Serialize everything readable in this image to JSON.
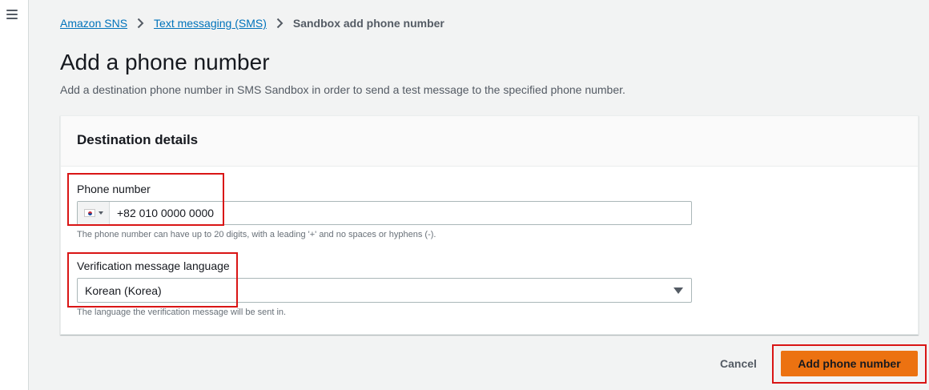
{
  "breadcrumb": {
    "items": [
      {
        "label": "Amazon SNS"
      },
      {
        "label": "Text messaging (SMS)"
      },
      {
        "label": "Sandbox add phone number"
      }
    ]
  },
  "page": {
    "title": "Add a phone number",
    "description": "Add a destination phone number in SMS Sandbox in order to send a test message to the specified phone number."
  },
  "destination": {
    "section_title": "Destination details",
    "phone": {
      "label": "Phone number",
      "country_flag": "south-korea-flag-icon",
      "value": "+82 010 0000 0000",
      "hint": "The phone number can have up to 20 digits, with a leading '+' and no spaces or hyphens (-)."
    },
    "language": {
      "label": "Verification message language",
      "selected": "Korean (Korea)",
      "hint": "The language the verification message will be sent in."
    }
  },
  "actions": {
    "cancel_label": "Cancel",
    "primary_label": "Add phone number"
  },
  "colors": {
    "primary_button": "#ec7211",
    "link": "#0073bb",
    "highlight_box": "#d91515"
  }
}
